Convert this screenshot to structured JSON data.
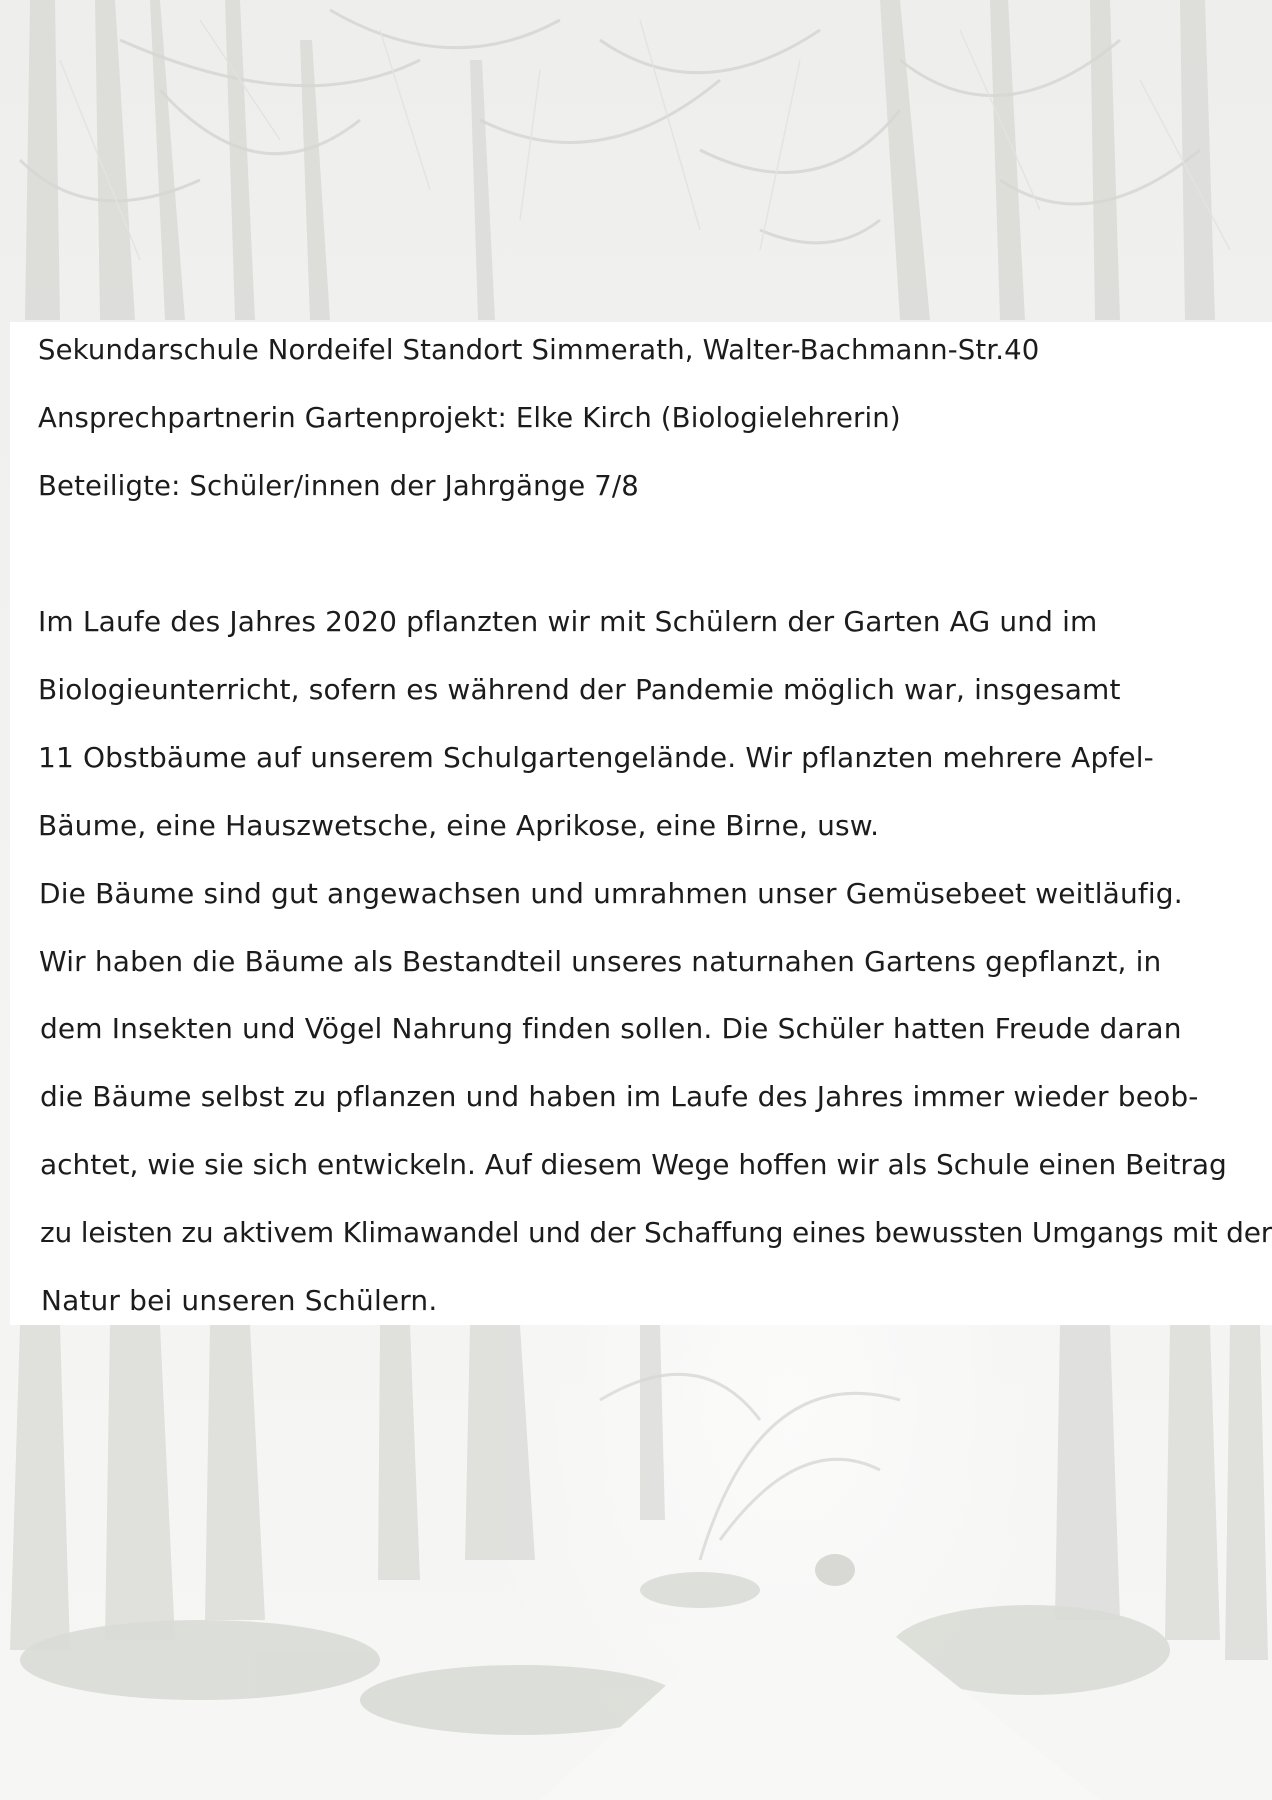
{
  "header": {
    "school": "Sekundarschule Nordeifel Standort Simmerath, Walter-Bachmann-Str.40",
    "contact": "Ansprechpartnerin Gartenprojekt: Elke Kirch (Biologielehrerin)",
    "participants": "Beteiligte: Schüler/innen der Jahrgänge 7/8"
  },
  "body_lines": [
    "Im Laufe des Jahres 2020 pflanzten wir mit Schülern der Garten AG und im",
    "Biologieunterricht, sofern es während der Pandemie möglich war, insgesamt",
    "11 Obstbäume auf unserem Schulgartengelände. Wir pflanzten mehrere Apfel-",
    "Bäume, eine Hauszwetsche, eine Aprikose, eine Birne, usw.",
    "Die Bäume sind gut angewachsen und umrahmen unser Gemüsebeet weitläufig.",
    "Wir haben die Bäume als Bestandteil unseres naturnahen Gartens gepflanzt, in",
    "dem Insekten und Vögel Nahrung finden sollen. Die Schüler hatten Freude daran",
    "die Bäume selbst zu pflanzen und haben im Laufe des Jahres immer wieder beob-",
    "achtet, wie sie sich entwickeln. Auf diesem Wege hoffen wir als Schule einen Beitrag",
    "zu leisten zu aktivem Klimawandel und der Schaffung eines bewussten Umgangs mit der",
    "Natur bei unseren Schülern."
  ]
}
